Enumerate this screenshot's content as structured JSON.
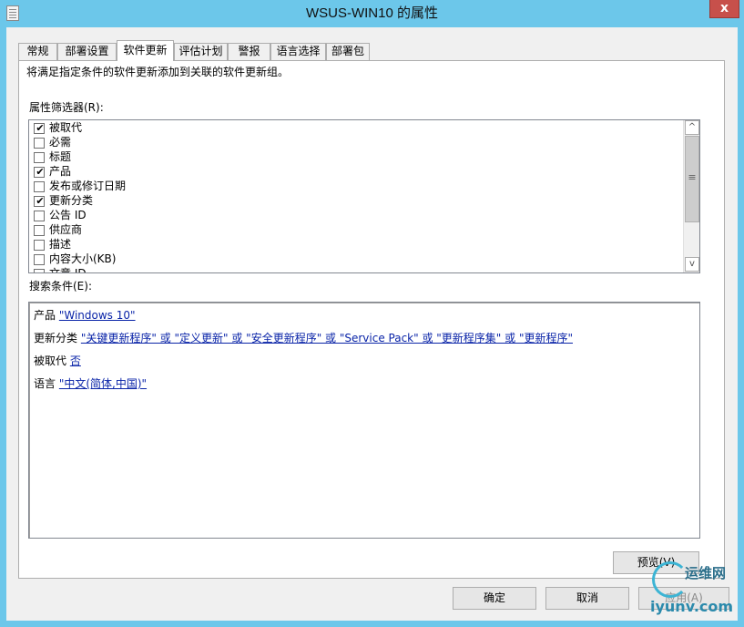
{
  "window": {
    "title": "WSUS-WIN10 的属性",
    "close_glyph": "x"
  },
  "tabs": [
    {
      "label": "常规"
    },
    {
      "label": "部署设置"
    },
    {
      "label": "软件更新"
    },
    {
      "label": "评估计划"
    },
    {
      "label": "警报"
    },
    {
      "label": "语言选择"
    },
    {
      "label": "部署包"
    }
  ],
  "panel": {
    "description": "将满足指定条件的软件更新添加到关联的软件更新组。",
    "filter_label": "属性筛选器(R):",
    "filters": [
      {
        "label": "被取代",
        "checked": true
      },
      {
        "label": "必需",
        "checked": false
      },
      {
        "label": "标题",
        "checked": false
      },
      {
        "label": "产品",
        "checked": true
      },
      {
        "label": "发布或修订日期",
        "checked": false
      },
      {
        "label": "更新分类",
        "checked": true
      },
      {
        "label": "公告 ID",
        "checked": false
      },
      {
        "label": "供应商",
        "checked": false
      },
      {
        "label": "描述",
        "checked": false
      },
      {
        "label": "内容大小(KB)",
        "checked": false
      },
      {
        "label": "文章 ID",
        "checked": false
      }
    ],
    "scroll_up_glyph": "^",
    "scroll_down_glyph": "v",
    "scroll_grip_glyph": "≡",
    "conditions_label": "搜索条件(E):",
    "conditions": [
      {
        "prefix": "产品",
        "value": "\"Windows 10\""
      },
      {
        "prefix": "更新分类",
        "value": "\"关键更新程序\" 或 \"定义更新\" 或 \"安全更新程序\" 或 \"Service Pack\" 或 \"更新程序集\" 或 \"更新程序\""
      },
      {
        "prefix": "被取代",
        "value": "否"
      },
      {
        "prefix": "语言",
        "value": "\"中文(简体,中国)\""
      }
    ],
    "preview_button": "预览(V)"
  },
  "buttons": {
    "ok": "确定",
    "cancel": "取消",
    "apply": "应用(A)"
  },
  "watermark": {
    "top": "运维网",
    "bottom": "iyunv.com"
  }
}
